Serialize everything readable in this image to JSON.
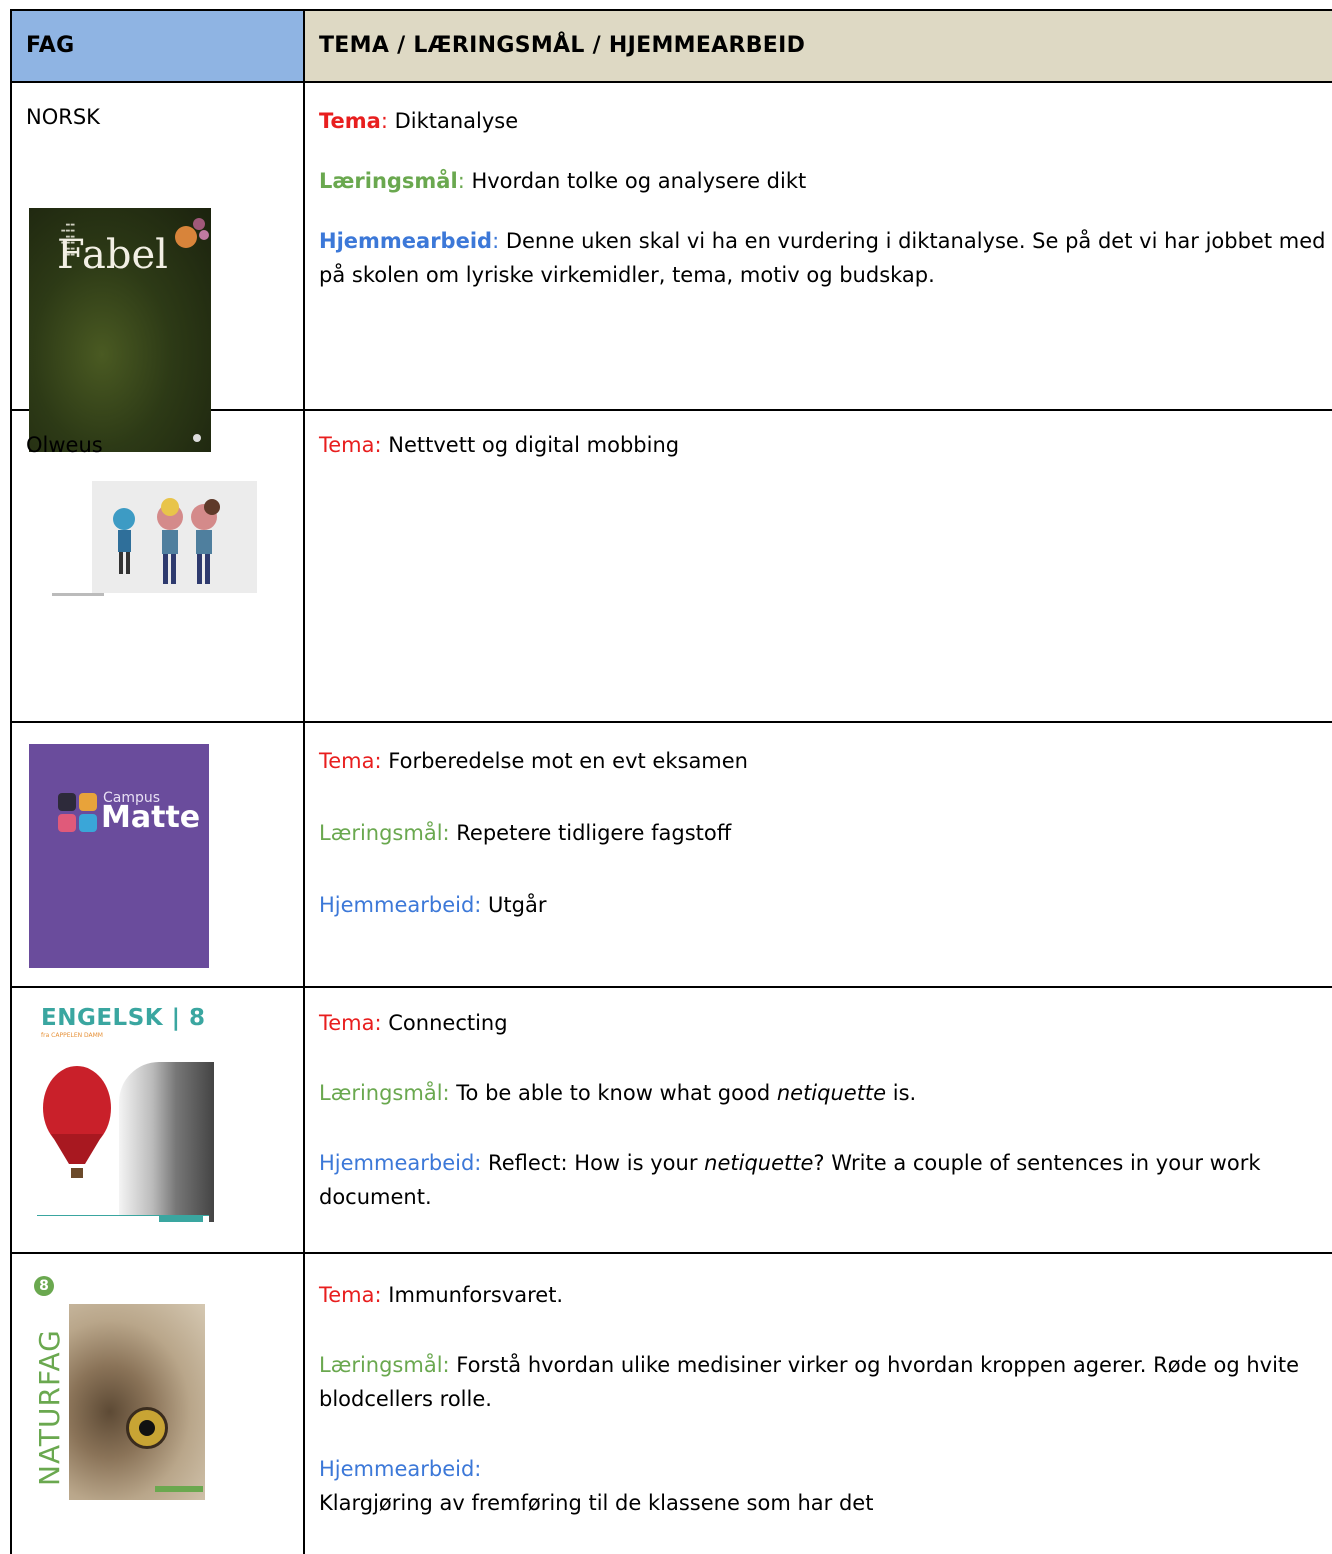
{
  "header": {
    "col1": "FAG",
    "col2": "TEMA / LÆRINGSMÅL / HJEMMEARBEID"
  },
  "labels": {
    "tema": "Tema",
    "tema_colon": "Tema:",
    "maal": "Læringsmål",
    "maal_colon": "Læringsmål:",
    "hjem": "Hjemmearbeid",
    "hjem_colon": "Hjemmearbeid:",
    "colon": ":"
  },
  "rows": {
    "norsk": {
      "subject": "NORSK",
      "cover_title": "Fabel",
      "tema": " Diktanalyse",
      "maal": " Hvordan tolke og analysere dikt",
      "hjem": " Denne uken skal vi ha en vurdering i diktanalyse. Se på det vi har jobbet med på skolen om lyriske virkemidler, tema, motiv og budskap."
    },
    "olweus": {
      "subject": "Olweus",
      "tema": " Nettvett og digital mobbing"
    },
    "matte": {
      "cover_small": "Campus",
      "cover_title": "Matte",
      "tema": " Forberedelse mot en evt eksamen",
      "maal": " Repetere tidligere fagstoff",
      "hjem": " Utgår"
    },
    "engelsk": {
      "cover_title": "ENGELSK | 8",
      "cover_sub": "fra CAPPELEN DAMM",
      "tema": " Connecting",
      "maal_a": " To be able to know what good ",
      "maal_em": "netiquette",
      "maal_b": " is.",
      "hjem_a": " Reflect: How is your ",
      "hjem_em": "netiquette",
      "hjem_b": "? Write a couple of sentences in your work document."
    },
    "naturfag": {
      "cover_title": "NATURFAG",
      "cover_num": "8",
      "tema": " Immunforsvaret.",
      "maal": " Forstå hvordan ulike medisiner virker og hvordan kroppen agerer. Røde og hvite blodcellers rolle.",
      "hjem": "Klargjøring av fremføring til de klassene som har det"
    }
  }
}
